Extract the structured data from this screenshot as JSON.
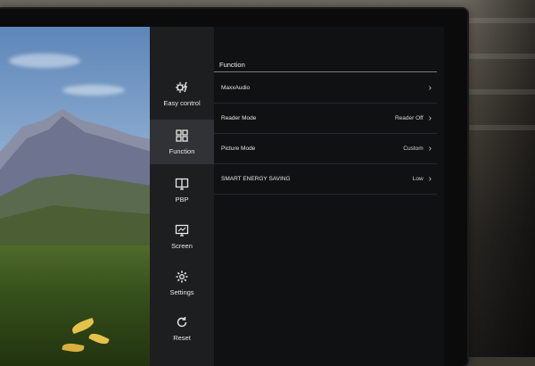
{
  "sidebar": {
    "items": [
      {
        "label": "Easy control",
        "icon": "easy-control-icon"
      },
      {
        "label": "Function",
        "icon": "function-grid-icon",
        "active": true
      },
      {
        "label": "PBP",
        "icon": "pbp-icon"
      },
      {
        "label": "Screen",
        "icon": "screen-icon"
      },
      {
        "label": "Settings",
        "icon": "gear-icon"
      },
      {
        "label": "Reset",
        "icon": "reset-icon"
      }
    ]
  },
  "main": {
    "title": "Function",
    "rows": [
      {
        "label": "MaxxAudio",
        "value": ""
      },
      {
        "label": "Reader Mode",
        "value": "Reader Off"
      },
      {
        "label": "Picture Mode",
        "value": "Custom"
      },
      {
        "label": "SMART ENERGY SAVING",
        "value": "Low"
      }
    ]
  },
  "colors": {
    "sidebar_bg": "#1d1e20",
    "sidebar_active_bg": "#313235",
    "panel_bg": "#101113",
    "text": "#e6e6e6"
  }
}
